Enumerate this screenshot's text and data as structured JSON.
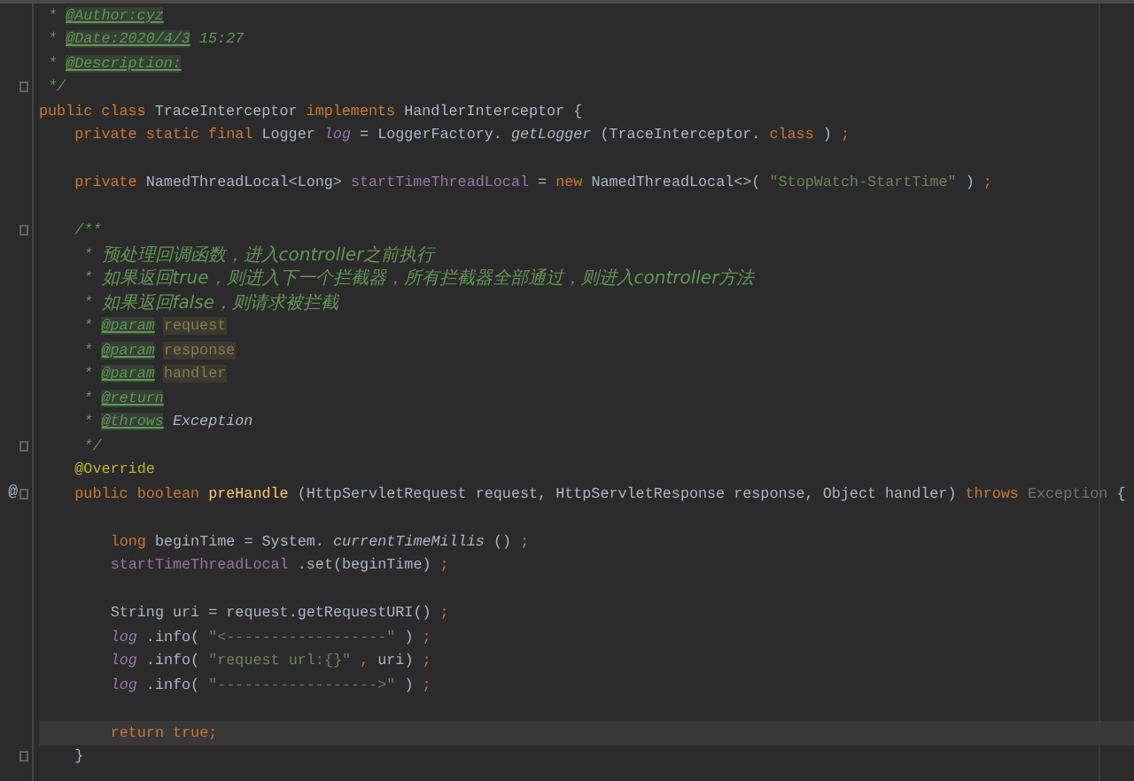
{
  "editor": {
    "lines": [
      {
        "fold": false,
        "selected": false,
        "tokens": [
          {
            "kind": "doccont",
            "text": "*"
          },
          {
            "kind": "doctag",
            "text": "@Author:cyz"
          }
        ]
      },
      {
        "fold": false,
        "selected": false,
        "tokens": [
          {
            "kind": "doccont",
            "text": "*"
          },
          {
            "kind": "doctag",
            "text": "@Date:2020/4/3"
          },
          {
            "kind": "doc",
            "text": "15:27"
          }
        ]
      },
      {
        "fold": false,
        "selected": false,
        "tokens": [
          {
            "kind": "doccont",
            "text": "*"
          },
          {
            "kind": "doctag",
            "text": "@Description:"
          }
        ]
      },
      {
        "fold": true,
        "selected": false,
        "tokens": [
          {
            "kind": "doccont",
            "text": "*/"
          }
        ]
      },
      {
        "fold": false,
        "selected": false,
        "tokens": [
          {
            "kind": "kw",
            "text": "public class"
          },
          {
            "kind": "plain",
            "text": "TraceInterceptor"
          },
          {
            "kind": "kw",
            "text": "implements"
          },
          {
            "kind": "plain",
            "text": "HandlerInterceptor {"
          }
        ],
        "children": [
          {
            "fold": false,
            "selected": false,
            "tokens": [
              {
                "kind": "kw",
                "text": "private static final"
              },
              {
                "kind": "plain",
                "text": "Logger"
              },
              {
                "kind": "sfield",
                "text": "log"
              },
              {
                "kind": "plain",
                "text": "= LoggerFactory."
              },
              {
                "kind": "scall",
                "text": "getLogger"
              },
              {
                "kind": "plain",
                "text": "(TraceInterceptor."
              },
              {
                "kind": "kw",
                "text": "class"
              },
              {
                "kind": "plain",
                "text": ")"
              },
              {
                "kind": "kw",
                "text": ";"
              }
            ]
          },
          {
            "fold": false,
            "selected": false
          },
          {
            "fold": false,
            "selected": false,
            "tokens": [
              {
                "kind": "kw",
                "text": "private"
              },
              {
                "kind": "plain",
                "text": "NamedThreadLocal<Long>"
              },
              {
                "kind": "field",
                "text": "startTimeThreadLocal"
              },
              {
                "kind": "plain",
                "text": "="
              },
              {
                "kind": "kw",
                "text": "new"
              },
              {
                "kind": "plain",
                "text": "NamedThreadLocal<>("
              },
              {
                "kind": "str",
                "text": "\"StopWatch-StartTime\""
              },
              {
                "kind": "plain",
                "text": ")"
              },
              {
                "kind": "kw",
                "text": ";"
              }
            ]
          },
          {
            "fold": false,
            "selected": false
          },
          {
            "fold": true,
            "selected": false,
            "tokens": [
              {
                "kind": "doc",
                "text": "/**"
              }
            ]
          },
          {
            "fold": false,
            "selected": false,
            "tokens": [
              {
                "kind": "doccont",
                "text": "*"
              },
              {
                "kind": "doctext",
                "text": "预处理回调函数，进入controller之前执行"
              }
            ]
          },
          {
            "fold": false,
            "selected": false,
            "tokens": [
              {
                "kind": "doccont",
                "text": "*"
              },
              {
                "kind": "doctext",
                "text": "如果返回true，则进入下一个拦截器，所有拦截器全部通过，则进入controller方法"
              }
            ]
          },
          {
            "fold": false,
            "selected": false,
            "tokens": [
              {
                "kind": "doccont",
                "text": "*"
              },
              {
                "kind": "doctext",
                "text": "如果返回false，则请求被拦截"
              }
            ]
          },
          {
            "fold": false,
            "selected": false,
            "tokens": [
              {
                "kind": "doccont",
                "text": "*"
              },
              {
                "kind": "doctag",
                "text": "@param"
              },
              {
                "kind": "docref",
                "text": "request"
              }
            ]
          },
          {
            "fold": false,
            "selected": false,
            "tokens": [
              {
                "kind": "doccont",
                "text": "*"
              },
              {
                "kind": "doctag",
                "text": "@param"
              },
              {
                "kind": "docref",
                "text": "response"
              }
            ]
          },
          {
            "fold": false,
            "selected": false,
            "tokens": [
              {
                "kind": "doccont",
                "text": "*"
              },
              {
                "kind": "doctag",
                "text": "@param"
              },
              {
                "kind": "docref",
                "text": "handler"
              }
            ]
          },
          {
            "fold": false,
            "selected": false,
            "tokens": [
              {
                "kind": "doccont",
                "text": "*"
              },
              {
                "kind": "doctag",
                "text": "@return"
              }
            ]
          },
          {
            "fold": false,
            "selected": false,
            "tokens": [
              {
                "kind": "doccont",
                "text": "*"
              },
              {
                "kind": "doctag",
                "text": "@throws"
              },
              {
                "kind": "doctype",
                "text": "Exception"
              }
            ]
          },
          {
            "fold": true,
            "selected": false,
            "tokens": [
              {
                "kind": "doccont",
                "text": "*/"
              }
            ]
          },
          {
            "fold": false,
            "selected": false,
            "tokens": [
              {
                "kind": "anno",
                "text": "@Override"
              }
            ]
          },
          {
            "gutter_mark": "@",
            "fold": true,
            "selected": false,
            "tokens": [
              {
                "kind": "kw",
                "text": "public boolean"
              },
              {
                "kind": "method",
                "text": "preHandle"
              },
              {
                "kind": "plain",
                "text": "(HttpServletRequest request, HttpServletResponse response, Object handler)"
              },
              {
                "kind": "kw",
                "text": "throws"
              },
              {
                "kind": "dim",
                "text": "Exception"
              },
              {
                "kind": "plain",
                "text": "{"
              }
            ],
            "children": [
              {
                "fold": false,
                "selected": false
              },
              {
                "fold": false,
                "selected": false,
                "tokens": [
                  {
                    "kind": "kw",
                    "text": "long"
                  },
                  {
                    "kind": "plain",
                    "text": "beginTime = System."
                  },
                  {
                    "kind": "scall",
                    "text": "currentTimeMillis"
                  },
                  {
                    "kind": "plain",
                    "text": "()"
                  },
                  {
                    "kind": "kw",
                    "text": ";"
                  }
                ]
              },
              {
                "fold": false,
                "selected": false,
                "tokens": [
                  {
                    "kind": "field",
                    "text": "startTimeThreadLocal"
                  },
                  {
                    "kind": "plain",
                    "text": ".set(beginTime)"
                  },
                  {
                    "kind": "kw",
                    "text": ";"
                  }
                ]
              },
              {
                "fold": false,
                "selected": false
              },
              {
                "fold": false,
                "selected": false,
                "tokens": [
                  {
                    "kind": "plain",
                    "text": "String uri = request.getRequestURI()"
                  },
                  {
                    "kind": "kw",
                    "text": ";"
                  }
                ]
              },
              {
                "fold": false,
                "selected": false,
                "tokens": [
                  {
                    "kind": "sfield",
                    "text": "log"
                  },
                  {
                    "kind": "plain",
                    "text": ".info("
                  },
                  {
                    "kind": "str",
                    "text": "\"<------------------\""
                  },
                  {
                    "kind": "plain",
                    "text": ")"
                  },
                  {
                    "kind": "kw",
                    "text": ";"
                  }
                ]
              },
              {
                "fold": false,
                "selected": false,
                "tokens": [
                  {
                    "kind": "sfield",
                    "text": "log"
                  },
                  {
                    "kind": "plain",
                    "text": ".info("
                  },
                  {
                    "kind": "str",
                    "text": "\"request url:{}\""
                  },
                  {
                    "kind": "kw",
                    "text": ","
                  },
                  {
                    "kind": "plain",
                    "text": "uri)"
                  },
                  {
                    "kind": "kw",
                    "text": ";"
                  }
                ]
              },
              {
                "fold": false,
                "selected": false,
                "tokens": [
                  {
                    "kind": "sfield",
                    "text": "log"
                  },
                  {
                    "kind": "plain",
                    "text": ".info("
                  },
                  {
                    "kind": "str",
                    "text": "\"------------------>\""
                  },
                  {
                    "kind": "plain",
                    "text": ")"
                  },
                  {
                    "kind": "kw",
                    "text": ";"
                  }
                ]
              },
              {
                "fold": false,
                "selected": false
              },
              {
                "fold": false,
                "selected": true,
                "tokens": [
                  {
                    "kind": "kw",
                    "text": "return true;"
                  }
                ]
              }
            ]
          },
          {
            "fold": true,
            "selected": false,
            "tokens": [
              {
                "kind": "plain",
                "text": "}"
              }
            ]
          }
        ]
      }
    ]
  }
}
